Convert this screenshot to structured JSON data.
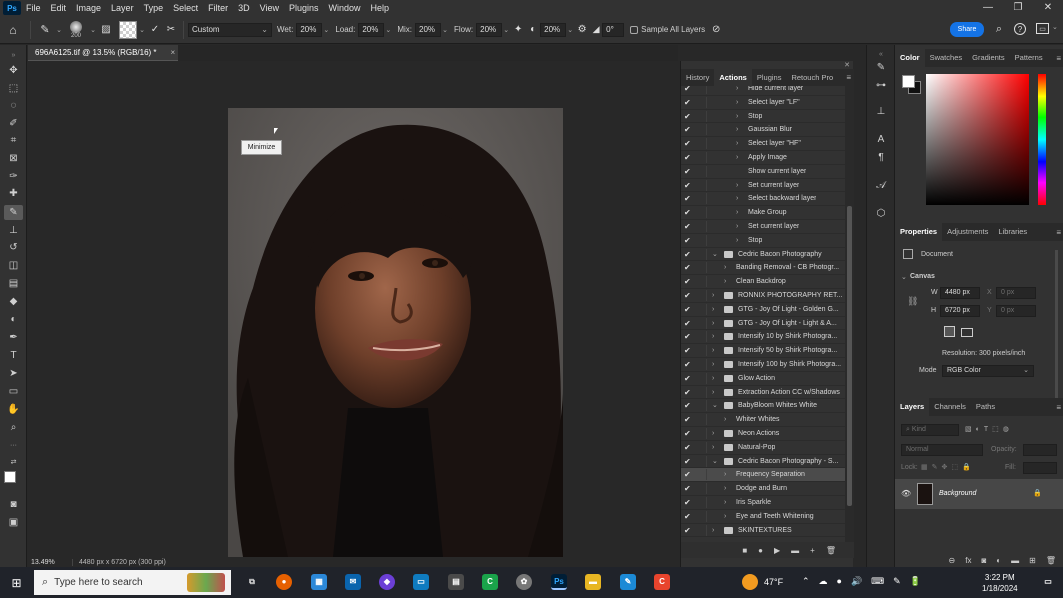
{
  "menubar": {
    "logo": "Ps",
    "items": [
      "File",
      "Edit",
      "Image",
      "Layer",
      "Type",
      "Select",
      "Filter",
      "3D",
      "View",
      "Plugins",
      "Window",
      "Help"
    ],
    "window_controls": [
      "—",
      "❐",
      "✕"
    ]
  },
  "options": {
    "brush_size": "200",
    "preset": "Custom",
    "wet_label": "Wet:",
    "wet": "20%",
    "load_label": "Load:",
    "load": "20%",
    "mix_label": "Mix:",
    "mix": "20%",
    "flow_label": "Flow:",
    "flow": "20%",
    "smoothing": "20%",
    "angle": "0°",
    "sample_all_label": "Sample All Layers",
    "share_label": "Share"
  },
  "document": {
    "tab_title": "696A6125.tif @ 13.5% (RGB/16) *",
    "close": "×",
    "zoom": "13.49%",
    "info": "4480 px x 6720 px (300 ppi)",
    "tooltip": "Minimize"
  },
  "actions_panel": {
    "tabs": [
      "History",
      "Actions",
      "Plugins",
      "Retouch Pro"
    ],
    "active_tab": "Actions",
    "rows": [
      {
        "text": "Hide current layer",
        "level": 2,
        "folder": false
      },
      {
        "text": "Select layer \"LF\"",
        "level": 2,
        "folder": false
      },
      {
        "text": "Stop",
        "level": 2,
        "folder": false
      },
      {
        "text": "Gaussian Blur",
        "level": 2,
        "folder": false
      },
      {
        "text": "Select layer \"HF\"",
        "level": 2,
        "folder": false
      },
      {
        "text": "Apply Image",
        "level": 2,
        "folder": false
      },
      {
        "text": "Show current layer",
        "level": 2,
        "folder": false,
        "nochevron": true
      },
      {
        "text": "Set current layer",
        "level": 2,
        "folder": false
      },
      {
        "text": "Select backward layer",
        "level": 2,
        "folder": false
      },
      {
        "text": "Make Group",
        "level": 2,
        "folder": false
      },
      {
        "text": "Set current layer",
        "level": 2,
        "folder": false
      },
      {
        "text": "Stop",
        "level": 2,
        "folder": false
      },
      {
        "text": "Cedric Bacon Photography",
        "level": 0,
        "folder": true,
        "open": true
      },
      {
        "text": "Banding Removal - CB Photogr...",
        "level": 1,
        "folder": false
      },
      {
        "text": "Clean Backdrop",
        "level": 1,
        "folder": false
      },
      {
        "text": "RONNIX PHOTOGRAPHY RET...",
        "level": 0,
        "folder": true
      },
      {
        "text": "GTG - Joy Of Light - Golden G...",
        "level": 0,
        "folder": true
      },
      {
        "text": "GTG - Joy Of Light - Light & A...",
        "level": 0,
        "folder": true
      },
      {
        "text": "Intensify 10 by Shirk Photogra...",
        "level": 0,
        "folder": true
      },
      {
        "text": "Intensify 50 by Shirk Photogra...",
        "level": 0,
        "folder": true
      },
      {
        "text": "Intensify 100 by Shirk Photogra...",
        "level": 0,
        "folder": true
      },
      {
        "text": "Glow Action",
        "level": 0,
        "folder": true
      },
      {
        "text": "Extraction Action CC w/Shadows",
        "level": 0,
        "folder": true
      },
      {
        "text": "BabyBloom Whites White",
        "level": 0,
        "folder": true,
        "open": true
      },
      {
        "text": "Whiter Whites",
        "level": 1,
        "folder": false
      },
      {
        "text": "Neon Actions",
        "level": 0,
        "folder": true
      },
      {
        "text": "Natural-Pop",
        "level": 0,
        "folder": true
      },
      {
        "text": "Cedric Bacon Photography - S...",
        "level": 0,
        "folder": true,
        "open": true
      },
      {
        "text": "Frequency Separation",
        "level": 1,
        "folder": false,
        "selected": true
      },
      {
        "text": "Dodge and Burn",
        "level": 1,
        "folder": false
      },
      {
        "text": "Iris Sparkle",
        "level": 1,
        "folder": false
      },
      {
        "text": "Eye and Teeth Whitening",
        "level": 1,
        "folder": false
      },
      {
        "text": "SKINTEXTURES",
        "level": 0,
        "folder": true
      }
    ],
    "footer_icons": [
      "■",
      "●",
      "▶",
      "▬",
      "+",
      "🗑"
    ]
  },
  "color_panel": {
    "tabs": [
      "Color",
      "Swatches",
      "Gradients",
      "Patterns"
    ],
    "active_tab": "Color"
  },
  "properties_panel": {
    "tabs": [
      "Properties",
      "Adjustments",
      "Libraries"
    ],
    "active_tab": "Properties",
    "type": "Document",
    "section": "Canvas",
    "w_label": "W",
    "w_value": "4480 px",
    "h_label": "H",
    "h_value": "6720 px",
    "x_label": "X",
    "x_placeholder": "0 px",
    "y_label": "Y",
    "y_placeholder": "0 px",
    "resolution": "Resolution: 300 pixels/inch",
    "mode_label": "Mode",
    "mode": "RGB Color"
  },
  "layers_panel": {
    "tabs": [
      "Layers",
      "Channels",
      "Paths"
    ],
    "active_tab": "Layers",
    "kind_placeholder": "Kind",
    "blend_mode": "Normal",
    "opacity_label": "Opacity:",
    "lock_label": "Lock:",
    "fill_label": "Fill:",
    "layer_name": "Background"
  },
  "taskbar": {
    "search_placeholder": "Type here to search",
    "weather": "47°F",
    "time": "3:22 PM",
    "date": "1/18/2024"
  }
}
